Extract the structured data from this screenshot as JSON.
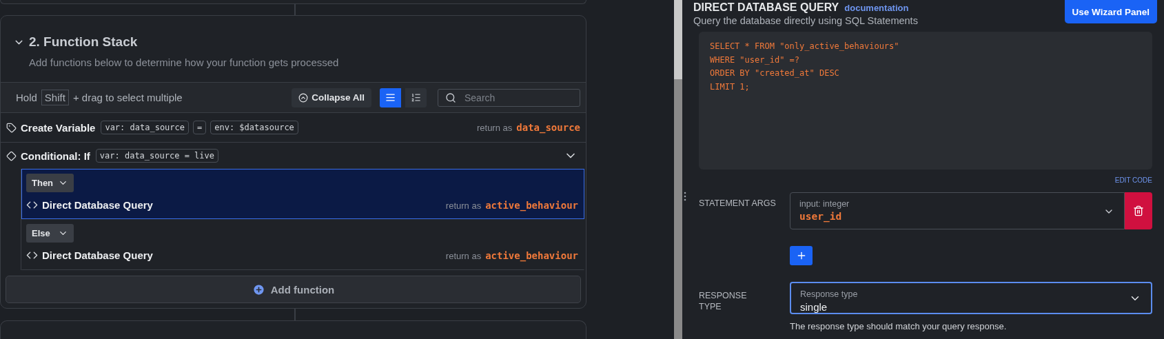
{
  "function_stack": {
    "title": "2. Function Stack",
    "expanded": true,
    "description": "Add functions below to determine how your function gets processed",
    "toolbar": {
      "hint_prefix": "Hold",
      "hint_key": "Shift",
      "hint_suffix": "+ drag to select multiple",
      "collapse_button": "Collapse All",
      "view_modes": [
        {
          "kind": "list",
          "selected": true
        },
        {
          "kind": "numbered",
          "selected": false
        }
      ],
      "search": {
        "placeholder": "Search"
      }
    },
    "steps": [
      {
        "kind": "variable",
        "title": "Create Variable",
        "tokens": [
          {
            "prefix": "var:",
            "text": "data_source"
          },
          {
            "text": "="
          },
          {
            "prefix": "env:",
            "text": "$datasource"
          }
        ],
        "return_label": "return as",
        "return_value": "data_source"
      },
      {
        "kind": "conditional",
        "title": "Conditional: If",
        "tokens": [
          {
            "prefix": "var:",
            "text": "data_source = live"
          }
        ],
        "expanded": true,
        "branches": [
          {
            "label": "Then",
            "selected": true,
            "step": {
              "title": "Direct Database Query",
              "return_label": "return as",
              "return_value": "active_behaviour"
            }
          },
          {
            "label": "Else",
            "selected": false,
            "step": {
              "title": "Direct Database Query",
              "return_label": "return as",
              "return_value": "active_behaviour"
            }
          }
        ]
      }
    ],
    "add_button": "Add function"
  },
  "query_panel": {
    "title": "DIRECT DATABASE QUERY",
    "doc_link": "documentation",
    "subtitle": "Query the database directly using SQL Statements",
    "wizard_button": "Use Wizard Panel",
    "code_lines": [
      "SELECT * FROM \"only_active_behaviours\"",
      "WHERE \"user_id\" =?",
      "ORDER BY \"created_at\" DESC",
      "LIMIT 1;"
    ],
    "edit_code": "EDIT CODE",
    "statement_args": {
      "label": "STATEMENT ARGS",
      "args": [
        {
          "type_label": "input: integer",
          "value": "user_id"
        }
      ]
    },
    "response": {
      "label": "RESPONSE TYPE",
      "field_label": "Response type",
      "value": "single",
      "focused": true,
      "helper": "The response type should match your query response."
    }
  }
}
